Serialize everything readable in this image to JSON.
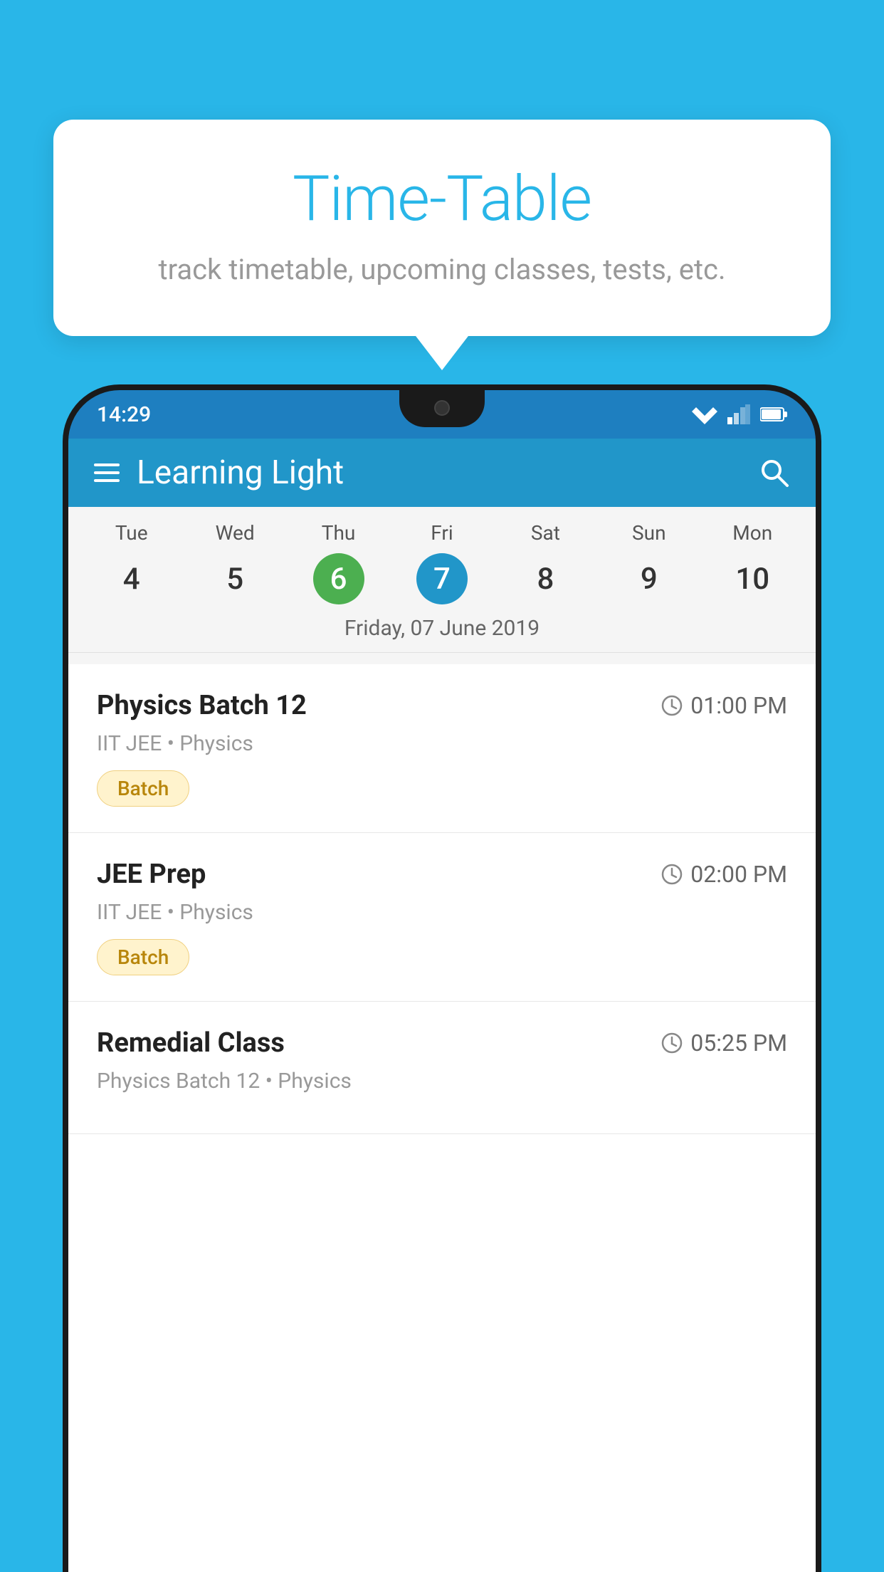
{
  "background_color": "#29b6e8",
  "tooltip": {
    "title": "Time-Table",
    "subtitle": "track timetable, upcoming classes, tests, etc."
  },
  "status_bar": {
    "time": "14:29"
  },
  "app_bar": {
    "title": "Learning Light"
  },
  "calendar": {
    "days": [
      {
        "name": "Tue",
        "num": "4",
        "state": "normal"
      },
      {
        "name": "Wed",
        "num": "5",
        "state": "normal"
      },
      {
        "name": "Thu",
        "num": "6",
        "state": "today"
      },
      {
        "name": "Fri",
        "num": "7",
        "state": "selected"
      },
      {
        "name": "Sat",
        "num": "8",
        "state": "normal"
      },
      {
        "name": "Sun",
        "num": "9",
        "state": "normal"
      },
      {
        "name": "Mon",
        "num": "10",
        "state": "normal"
      }
    ],
    "selected_label": "Friday, 07 June 2019"
  },
  "schedule": [
    {
      "title": "Physics Batch 12",
      "time": "01:00 PM",
      "subtitle": "IIT JEE • Physics",
      "tag": "Batch"
    },
    {
      "title": "JEE Prep",
      "time": "02:00 PM",
      "subtitle": "IIT JEE • Physics",
      "tag": "Batch"
    },
    {
      "title": "Remedial Class",
      "time": "05:25 PM",
      "subtitle": "Physics Batch 12 • Physics",
      "tag": ""
    }
  ]
}
